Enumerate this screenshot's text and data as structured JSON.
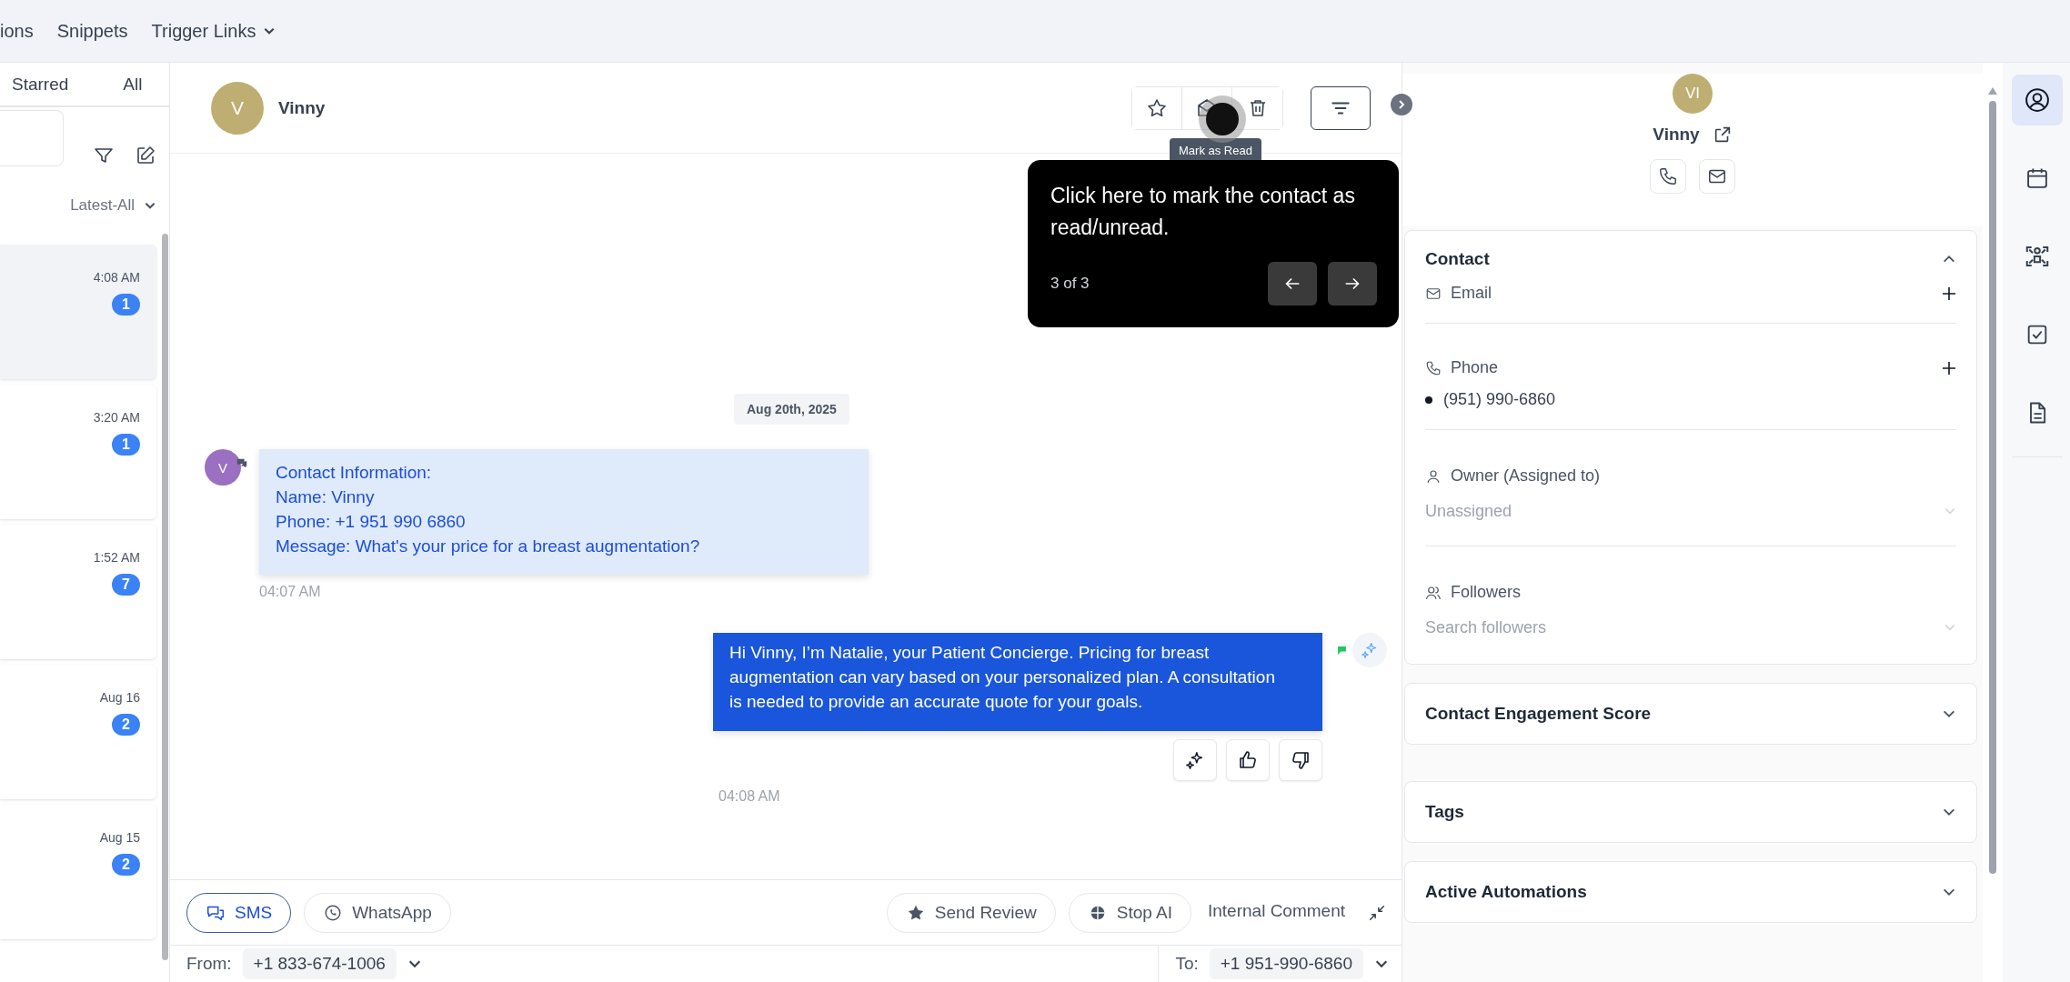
{
  "top_nav": [
    {
      "label": "ions",
      "dropdown": false
    },
    {
      "label": "Snippets",
      "dropdown": false
    },
    {
      "label": "Trigger Links",
      "dropdown": true
    }
  ],
  "inbox": {
    "tabs": [
      {
        "label": "Starred",
        "selected": false
      },
      {
        "label": "All",
        "selected": false
      }
    ],
    "sort": "Latest-All",
    "conversations": [
      {
        "time": "4:08 AM",
        "unread": "1",
        "selected": true
      },
      {
        "time": "3:20 AM",
        "unread": "1",
        "selected": false
      },
      {
        "time": "1:52 AM",
        "unread": "7",
        "selected": false
      },
      {
        "time": "Aug 16",
        "unread": "2",
        "selected": false
      },
      {
        "time": "Aug 15",
        "unread": "2",
        "selected": false
      }
    ]
  },
  "chat": {
    "contact": {
      "initial": "V",
      "name": "Vinny"
    },
    "tooltip": "Mark as Read",
    "tour": {
      "text": "Click here to mark the contact as read/unread.",
      "step": "3 of 3"
    },
    "date": "Aug 20th, 2025",
    "messages": [
      {
        "kind": "inbound",
        "initial": "V",
        "lines": [
          "Contact Information:",
          "Name: Vinny",
          "Phone: +1 951 990 6860",
          "Message: What's your price for a breast augmentation?"
        ],
        "time": "04:07 AM"
      },
      {
        "kind": "outbound",
        "lines": [
          "Hi Vinny, I’m Natalie, your Patient Concierge. Pricing for breast augmentation can vary based on your personalized plan. A consultation is needed to provide an accurate quote for your goals."
        ],
        "time": "04:08 AM"
      }
    ],
    "channels": [
      {
        "label": "SMS",
        "kind": "sms",
        "selected": true
      },
      {
        "label": "WhatsApp",
        "kind": "whatsapp",
        "selected": false
      }
    ],
    "actions": [
      {
        "label": "Send Review",
        "kind": "review"
      },
      {
        "label": "Stop AI",
        "kind": "stop"
      },
      {
        "label": "Internal Comment",
        "kind": "comment"
      }
    ],
    "from": {
      "label": "From:",
      "value": "+1 833-674-1006"
    },
    "to": {
      "label": "To:",
      "value": "+1 951-990-6860"
    }
  },
  "contact_panel": {
    "initials": "VI",
    "name": "Vinny",
    "section": {
      "title": "Contact",
      "expanded": true
    },
    "fields": [
      {
        "kind": "email",
        "label": "Email"
      },
      {
        "kind": "phone",
        "label": "Phone",
        "value": "(951) 990-6860"
      },
      {
        "kind": "owner",
        "label": "Owner (Assigned to)",
        "placeholder": "Unassigned"
      },
      {
        "kind": "followers",
        "label": "Followers",
        "placeholder": "Search followers"
      }
    ],
    "sections": [
      {
        "title": "Contact Engagement Score",
        "expanded": false
      },
      {
        "title": "Tags",
        "expanded": false
      },
      {
        "title": "Active Automations",
        "expanded": false
      }
    ]
  },
  "rail": [
    {
      "kind": "contact",
      "selected": true
    },
    {
      "kind": "calendar",
      "selected": false
    },
    {
      "kind": "network",
      "selected": false
    },
    {
      "kind": "task",
      "selected": false
    },
    {
      "kind": "document",
      "selected": false
    }
  ]
}
